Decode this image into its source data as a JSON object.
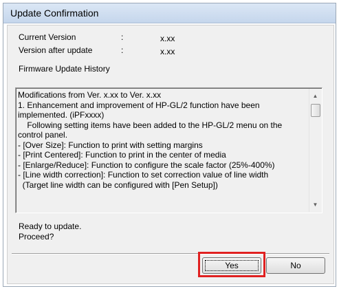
{
  "window": {
    "title": "Update Confirmation"
  },
  "info": {
    "current_version_label": "Current Version",
    "current_version_colon": ":",
    "current_version_value": "x.xx",
    "after_version_label": "Version after update",
    "after_version_colon": ":",
    "after_version_value": "x.xx",
    "history_label": "Firmware Update History"
  },
  "history": {
    "lines": [
      "Modifications from Ver. x.xx to Ver. x.xx",
      "1. Enhancement and improvement of HP-GL/2 function have been",
      "implemented. (iPFxxxx)",
      "    Following setting items have been added to the HP-GL/2 menu on the",
      "control panel.",
      "- [Over Size]: Function to print with setting margins",
      "- [Print Centered]: Function to print in the center of media",
      "- [Enlarge/Reduce]: Function to configure the scale factor (25%-400%)",
      "- [Line width correction]: Function to set correction value of line width",
      "  (Target line width can be configured with [Pen Setup])"
    ]
  },
  "status": {
    "ready": "Ready to update.",
    "proceed": "Proceed?"
  },
  "buttons": {
    "yes": "Yes",
    "no": "No"
  },
  "colors": {
    "highlight": "#e02020",
    "titlebar": "#c5d6ec"
  }
}
